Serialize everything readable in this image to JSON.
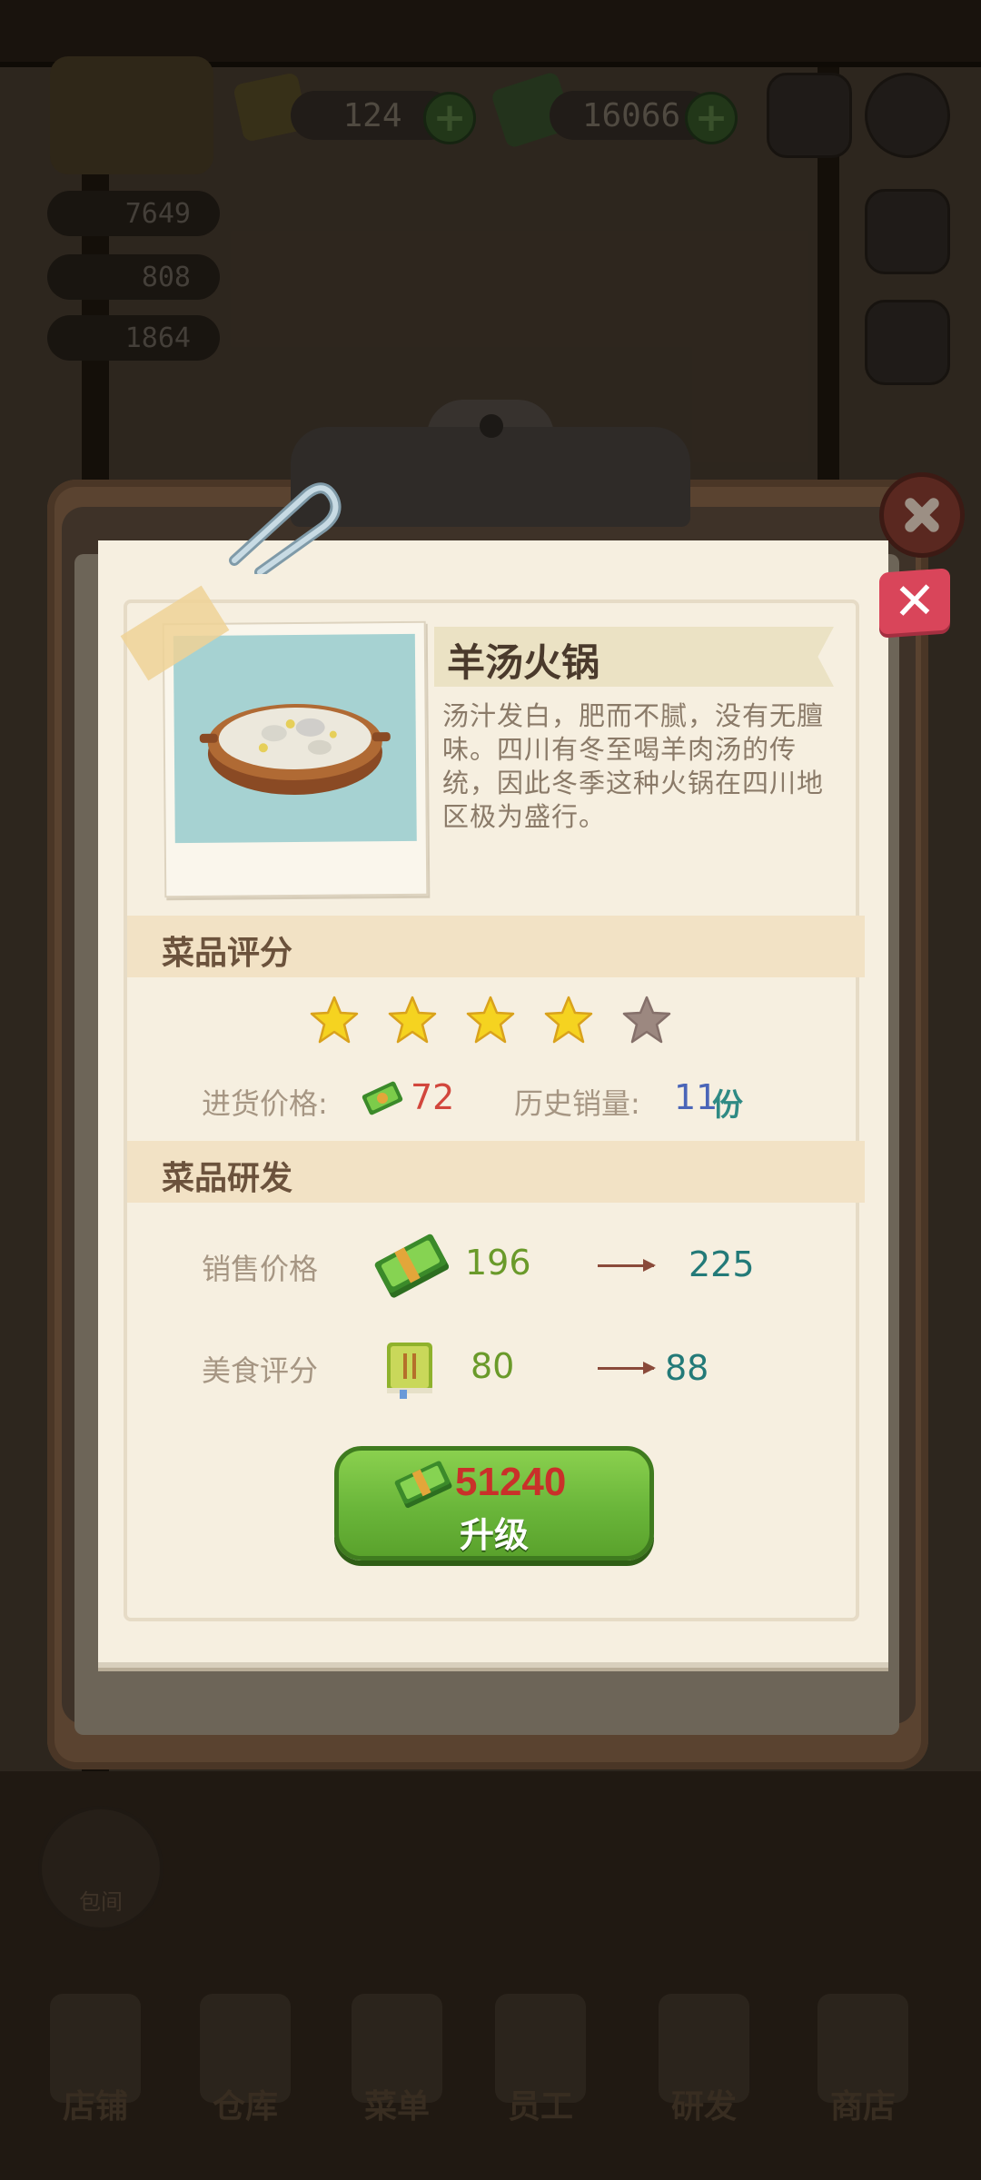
{
  "hud": {
    "gems": "124",
    "cash": "16066",
    "stats": [
      "7649",
      "808",
      "1864"
    ]
  },
  "dish": {
    "name": "羊汤火锅",
    "description": "汤汁发白，肥而不腻，没有无膻味。四川有冬至喝羊肉汤的传统，因此冬季这种火锅在四川地区极为盛行。",
    "rating_header": "菜品评分",
    "stars_total": 5,
    "stars_filled": 4,
    "purchase_price_label": "进货价格:",
    "purchase_price": "72",
    "history_sales_label": "历史销量:",
    "history_sales": "11",
    "history_sales_unit": "份",
    "research_header": "菜品研发",
    "sale_price_label": "销售价格",
    "sale_price_current": "196",
    "sale_price_next": "225",
    "food_score_label": "美食评分",
    "food_score_current": "80",
    "food_score_next": "88",
    "upgrade_cost": "51240",
    "upgrade_label": "升级"
  },
  "room_button": "包间",
  "nav": [
    "店铺",
    "仓库",
    "菜单",
    "员工",
    "研发",
    "商店"
  ],
  "colors": {
    "upgrade_green": "#6ab63a",
    "close_red": "#d9455a",
    "star_yellow": "#f5d320",
    "star_empty": "#9c8880"
  }
}
